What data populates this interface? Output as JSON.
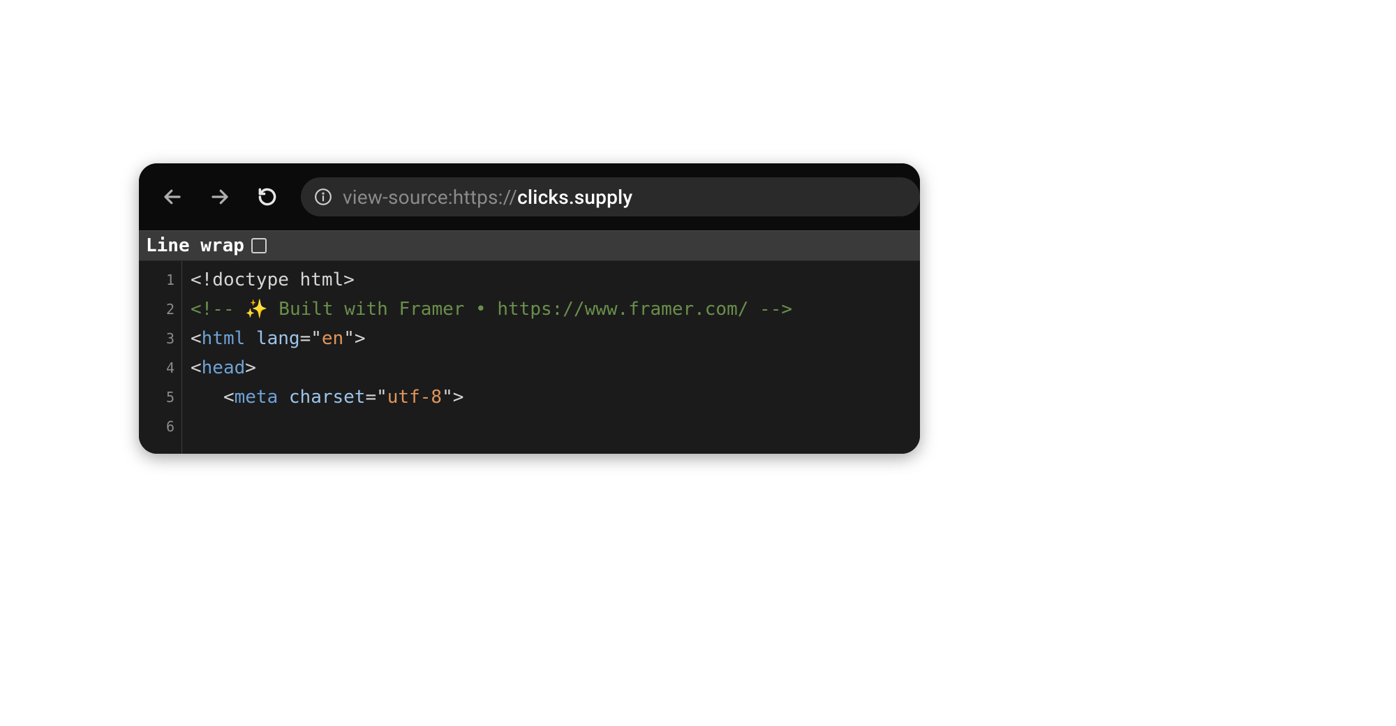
{
  "toolbar": {
    "back_icon": "back-icon",
    "forward_icon": "forward-icon",
    "reload_icon": "reload-icon",
    "site_info_icon": "info-icon"
  },
  "address": {
    "prefix": "view-source:https://",
    "host": "clicks.supply"
  },
  "options": {
    "line_wrap_label": "Line wrap",
    "line_wrap_checked": false
  },
  "source": {
    "line_numbers": [
      "1",
      "2",
      "3",
      "4",
      "5",
      "6"
    ],
    "lines": [
      {
        "tokens": [
          {
            "cls": "t-text",
            "text": "<!doctype html>"
          }
        ]
      },
      {
        "tokens": [
          {
            "cls": "t-comment",
            "text": "<!-- ✨ Built with Framer • https://www.framer.com/ -->"
          }
        ]
      },
      {
        "tokens": [
          {
            "cls": "t-punct",
            "text": "<"
          },
          {
            "cls": "t-tag",
            "text": "html"
          },
          {
            "cls": "t-text",
            "text": " "
          },
          {
            "cls": "t-attr",
            "text": "lang"
          },
          {
            "cls": "t-punct",
            "text": "="
          },
          {
            "cls": "t-punct",
            "text": "\""
          },
          {
            "cls": "t-string",
            "text": "en"
          },
          {
            "cls": "t-punct",
            "text": "\""
          },
          {
            "cls": "t-punct",
            "text": ">"
          }
        ]
      },
      {
        "tokens": [
          {
            "cls": "t-punct",
            "text": "<"
          },
          {
            "cls": "t-tag",
            "text": "head"
          },
          {
            "cls": "t-punct",
            "text": ">"
          }
        ]
      },
      {
        "indent": 1,
        "tokens": [
          {
            "cls": "t-punct",
            "text": "<"
          },
          {
            "cls": "t-tag",
            "text": "meta"
          },
          {
            "cls": "t-text",
            "text": " "
          },
          {
            "cls": "t-attr",
            "text": "charset"
          },
          {
            "cls": "t-punct",
            "text": "="
          },
          {
            "cls": "t-punct",
            "text": "\""
          },
          {
            "cls": "t-string",
            "text": "utf-8"
          },
          {
            "cls": "t-punct",
            "text": "\""
          },
          {
            "cls": "t-punct",
            "text": ">"
          }
        ]
      },
      {
        "tokens": []
      }
    ]
  }
}
